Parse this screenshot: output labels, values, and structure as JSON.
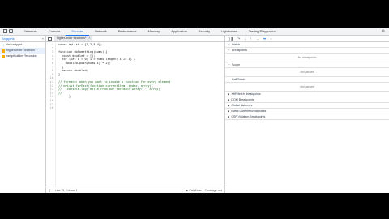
{
  "tabs": [
    "Elements",
    "Console",
    "Sources",
    "Network",
    "Performance",
    "Memory",
    "Application",
    "Security",
    "Lighthouse",
    "Testing Playground"
  ],
  "navigator": {
    "title": "Snippets",
    "more": "»",
    "new_snippet": "New snippet",
    "files": [
      "higher-order functions",
      "rangeBuilder Recursion"
    ]
  },
  "editor": {
    "tab_label": "higher-order functions*",
    "tab_close": "×",
    "lines": [
      "const myList = [1,2,3,4];",
      "",
      "function doSomething(nums) {",
      "  const doubled = [];",
      "  for (let i = 0; i < nums.length; i += 1) {",
      "    doubled.push(nums[i] * 2);",
      "  }",
      "  return doubled;",
      "}",
      "",
      "// foreach: when you want to invoke a function for every element",
      "// myList.forEach(function(currentItem, index, array){",
      "//   console.log('Hello from our forEach! Array: ', array)",
      "//",
      "      }",
      "",
      "",
      ""
    ],
    "status": {
      "position": "Line 15, Column 1",
      "run": "▶ Ctrl+Enter",
      "coverage": "Coverage: n/a"
    }
  },
  "debugger": {
    "sections": [
      {
        "title": "Watch",
        "open": true,
        "empty": null
      },
      {
        "title": "Breakpoints",
        "open": true,
        "empty": "No breakpoints"
      },
      {
        "title": "Scope",
        "open": true,
        "empty": "Not paused"
      },
      {
        "title": "Call Stack",
        "open": true,
        "empty": "Not paused"
      },
      {
        "title": "XHR/fetch Breakpoints",
        "open": false,
        "empty": null
      },
      {
        "title": "DOM Breakpoints",
        "open": false,
        "empty": null
      },
      {
        "title": "Global Listeners",
        "open": false,
        "empty": null
      },
      {
        "title": "Event Listener Breakpoints",
        "open": false,
        "empty": null
      },
      {
        "title": "CSP Violation Breakpoints",
        "open": false,
        "empty": null
      }
    ]
  }
}
